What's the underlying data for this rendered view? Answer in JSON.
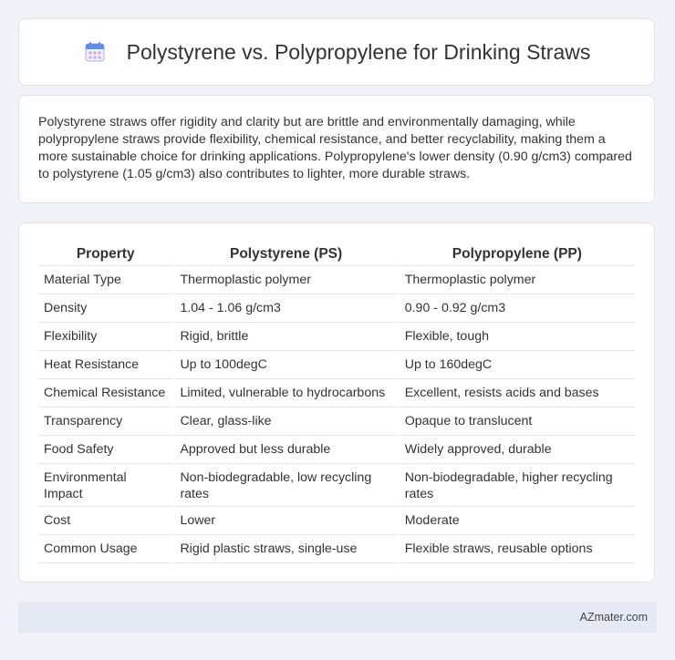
{
  "header": {
    "title": "Polystyrene vs. Polypropylene for Drinking Straws",
    "icon": "calendar-icon"
  },
  "summary": {
    "text": "Polystyrene straws offer rigidity and clarity but are brittle and environmentally damaging, while polypropylene straws provide flexibility, chemical resistance, and better recyclability, making them a more sustainable choice for drinking applications. Polypropylene's lower density (0.90 g/cm3) compared to polystyrene (1.05 g/cm3) also contributes to lighter, more durable straws."
  },
  "table": {
    "headers": [
      "Property",
      "Polystyrene (PS)",
      "Polypropylene (PP)"
    ],
    "rows": [
      [
        "Material Type",
        "Thermoplastic polymer",
        "Thermoplastic polymer"
      ],
      [
        "Density",
        "1.04 - 1.06 g/cm3",
        "0.90 - 0.92 g/cm3"
      ],
      [
        "Flexibility",
        "Rigid, brittle",
        "Flexible, tough"
      ],
      [
        "Heat Resistance",
        "Up to 100degC",
        "Up to 160degC"
      ],
      [
        "Chemical Resistance",
        "Limited, vulnerable to hydrocarbons",
        "Excellent, resists acids and bases"
      ],
      [
        "Transparency",
        "Clear, glass-like",
        "Opaque to translucent"
      ],
      [
        "Food Safety",
        "Approved but less durable",
        "Widely approved, durable"
      ],
      [
        "Environmental Impact",
        "Non-biodegradable, low recycling rates",
        "Non-biodegradable, higher recycling rates"
      ],
      [
        "Cost",
        "Lower",
        "Moderate"
      ],
      [
        "Common Usage",
        "Rigid plastic straws, single-use",
        "Flexible straws, reusable options"
      ]
    ]
  },
  "footer": {
    "brand": "AZmater.com"
  },
  "colors": {
    "background": "#f1f3f8",
    "card": "#ffffff",
    "footer": "#e5e9f3",
    "icon_primary": "#5b8def",
    "icon_accent": "#c9a4e8"
  }
}
